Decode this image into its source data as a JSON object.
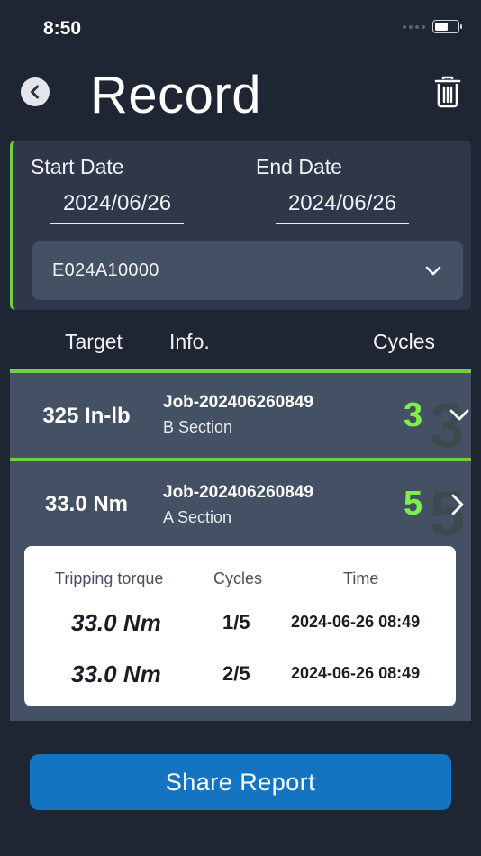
{
  "status_bar": {
    "time": "8:50",
    "battery_percent": 60
  },
  "header": {
    "title": "Record",
    "back_icon": "chevron-left-icon",
    "delete_icon": "trash-icon"
  },
  "filter": {
    "start_label": "Start Date",
    "start_value": "2024/06/26",
    "end_label": "End Date",
    "end_value": "2024/06/26",
    "device_value": "E024A10000"
  },
  "columns": {
    "target": "Target",
    "info": "Info.",
    "cycles": "Cycles"
  },
  "records": [
    {
      "target": "325 In-lb",
      "job": "Job-202406260849",
      "section": "B Section",
      "cycles": "3",
      "expanded": true
    },
    {
      "target": "33.0 Nm",
      "job": "Job-202406260849",
      "section": "A Section",
      "cycles": "5",
      "expanded": false,
      "details": {
        "headers": {
          "torque": "Tripping torque",
          "cycles": "Cycles",
          "time": "Time"
        },
        "rows": [
          {
            "torque": "33.0 Nm",
            "cycle": "1/5",
            "time": "2024-06-26 08:49"
          },
          {
            "torque": "33.0 Nm",
            "cycle": "2/5",
            "time": "2024-06-26 08:49"
          }
        ]
      }
    }
  ],
  "share_label": "Share Report",
  "colors": {
    "accent_green": "#7ff049",
    "bar_green": "#6fcf45",
    "button_blue": "#1574c2",
    "background": "#1f2633"
  }
}
